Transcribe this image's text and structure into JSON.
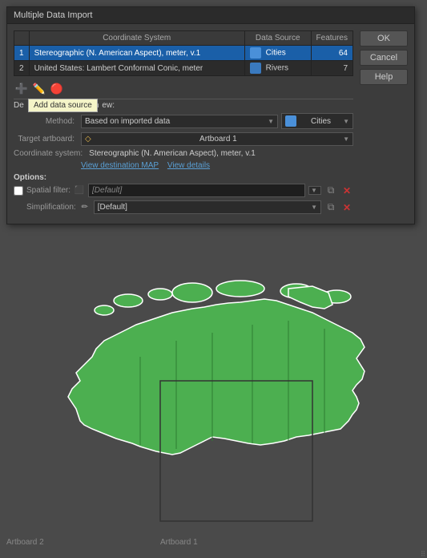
{
  "dialog": {
    "title": "Multiple Data Import",
    "table": {
      "headers": [
        "Coordinate System",
        "Data Source",
        "Features"
      ],
      "rows": [
        {
          "num": "1",
          "coordinate_system": "Stereographic (N. American Aspect), meter, v.1",
          "data_source": "Cities",
          "features": "64",
          "selected": true
        },
        {
          "num": "2",
          "coordinate_system": "United States: Lambert Conformal Conic, meter",
          "data_source": "Rivers",
          "features": "7",
          "selected": false
        }
      ]
    },
    "toolbar": {
      "tooltip": "Add data source"
    },
    "form": {
      "destination_label": "De",
      "destination_suffix": "ew:",
      "method_label": "Method:",
      "method_value": "Based on imported data",
      "layer_label": "Cities",
      "target_artboard_label": "Target artboard:",
      "target_artboard_value": "Artboard 1",
      "coordinate_system_label": "Coordinate system:",
      "coordinate_system_value": "Stereographic (N. American Aspect), meter, v.1",
      "view_destination_map": "View destination MAP",
      "view_details": "View details",
      "options_label": "Options:",
      "spatial_filter_label": "Spatial filter:",
      "spatial_filter_placeholder": "[Default]",
      "simplification_label": "Simplification:",
      "simplification_value": "[Default]"
    },
    "buttons": {
      "ok": "OK",
      "cancel": "Cancel",
      "help": "Help"
    }
  },
  "map": {
    "artboard1_label": "Artboard 1",
    "artboard2_label": "Artboard 2"
  }
}
